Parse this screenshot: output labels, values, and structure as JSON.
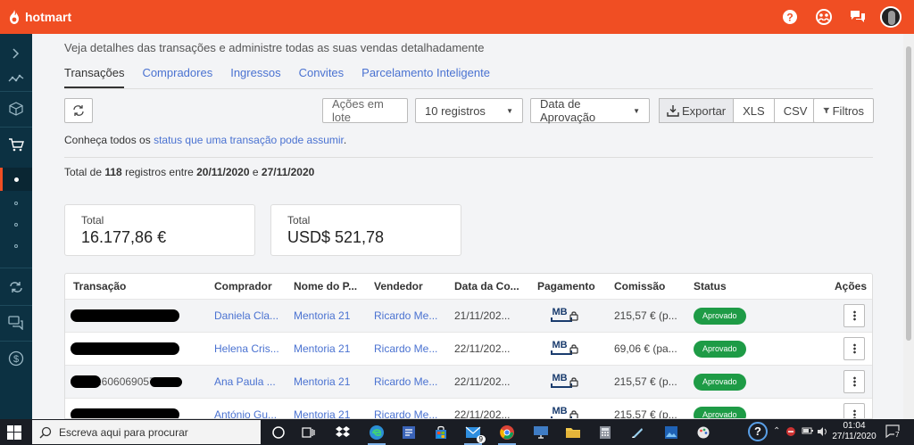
{
  "brand": {
    "name": "hotmart",
    "color": "#f04e23"
  },
  "header": {
    "icons": [
      "help-icon",
      "community-icon",
      "chat-icon",
      "user-avatar"
    ]
  },
  "sidebar": {
    "icons": [
      "chevron-right-icon",
      "analytics-icon",
      "product-box-icon",
      "cart-icon",
      "dot-icon",
      "circle-icon",
      "circle-icon",
      "circle-icon",
      "sync-icon",
      "messages-icon",
      "dollar-icon"
    ]
  },
  "page": {
    "subtitle": "Veja detalhes das transações e administre todas as suas vendas detalhadamente",
    "tabs": [
      {
        "label": "Transações",
        "active": true
      },
      {
        "label": "Compradores"
      },
      {
        "label": "Ingressos"
      },
      {
        "label": "Convites"
      },
      {
        "label": "Parcelamento Inteligente"
      }
    ]
  },
  "toolbar": {
    "batch_actions": "Ações em lote",
    "records_select": "10 registros",
    "date_select": "Data de Aprovação",
    "export": "Exportar",
    "xls": "XLS",
    "csv": "CSV",
    "filters": "Filtros"
  },
  "status_note": {
    "prefix": "Conheça todos os",
    "link": "status que uma transação pode assumir",
    "suffix": "."
  },
  "summary": {
    "p1": "Total de",
    "count": "118",
    "p2": "registros entre",
    "start": "20/11/2020",
    "p3": "e",
    "end": "27/11/2020"
  },
  "cards": [
    {
      "label": "Total",
      "value": "16.177,86 €"
    },
    {
      "label": "Total",
      "value": "USD$ 521,78"
    }
  ],
  "table": {
    "headers": [
      "Transação",
      "Comprador",
      "Nome do P...",
      "Vendedor",
      "Data da Co...",
      "Pagamento",
      "Comissão",
      "Status",
      "Ações"
    ],
    "rows": [
      {
        "transaction_partial": "",
        "buyer": "Daniela Cla...",
        "product": "Mentoria 21",
        "seller": "Ricardo Me...",
        "date": "21/11/202...",
        "payment": "MB",
        "commission": "215,57 € (p...",
        "status": "Aprovado"
      },
      {
        "transaction_partial": "",
        "buyer": "Helena Cris...",
        "product": "Mentoria 21",
        "seller": "Ricardo Me...",
        "date": "22/11/202...",
        "payment": "MB",
        "commission": "69,06 € (pa...",
        "status": "Aprovado"
      },
      {
        "transaction_partial": "1606069057",
        "buyer": "Ana Paula ...",
        "product": "Mentoria 21",
        "seller": "Ricardo Me...",
        "date": "22/11/202...",
        "payment": "MB",
        "commission": "215,57 € (p...",
        "status": "Aprovado"
      },
      {
        "transaction_partial": "",
        "buyer": "António Gu...",
        "product": "Mentoria 21",
        "seller": "Ricardo Me...",
        "date": "22/11/202...",
        "payment": "MB",
        "commission": "215,57 € (p...",
        "status": "Aprovado"
      }
    ]
  },
  "taskbar": {
    "search_placeholder": "Escreva aqui para procurar",
    "mail_badge": "9",
    "time": "01:04",
    "date": "27/11/2020",
    "notification_count": "7",
    "help": "?"
  }
}
